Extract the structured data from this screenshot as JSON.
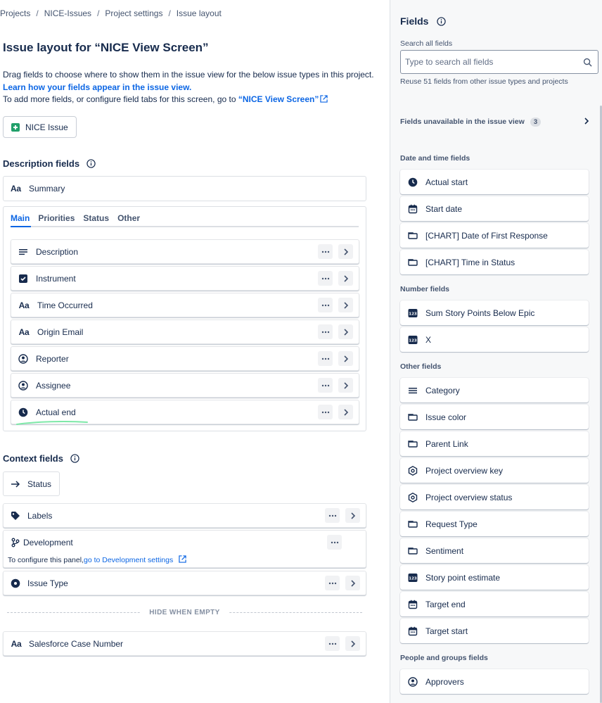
{
  "breadcrumb": [
    "Projects",
    "NICE-Issues",
    "Project settings",
    "Issue layout"
  ],
  "page_title": "Issue layout for “NICE View Screen”",
  "intro": {
    "line1": "Drag fields to choose where to show them in the issue view for the below issue types in this project. ",
    "link1": "Learn how your fields appear in the issue view.",
    "line2": "To add more fields, or configure field tabs for this screen, go to ",
    "link2": "“NICE View Screen”"
  },
  "issue_type_button": "NICE Issue",
  "description_section": {
    "title": "Description fields",
    "summary": "Summary",
    "tabs": [
      "Main",
      "Priorities",
      "Status",
      "Other"
    ],
    "rows": [
      "Description",
      "Instrument",
      "Time Occurred",
      "Origin Email",
      "Reporter",
      "Assignee",
      "Actual end"
    ]
  },
  "context_section": {
    "title": "Context fields",
    "status": "Status",
    "labels": "Labels",
    "development": "Development",
    "dev_note_prefix": "To configure this panel,",
    "dev_note_link": "go to Development settings",
    "issue_type": "Issue Type",
    "hide_when_empty": "HIDE WHEN EMPTY",
    "salesforce": "Salesforce Case Number"
  },
  "sidebar": {
    "title": "Fields",
    "search_label": "Search all fields",
    "search_placeholder": "Type to search all fields",
    "reuse_note": "Reuse 51 fields from other issue types and projects",
    "unavailable_label": "Fields unavailable in the issue view",
    "unavailable_count": "3",
    "groups": {
      "date": {
        "title": "Date and time fields",
        "items": [
          "Actual start",
          "Start date",
          "[CHART] Date of First Response",
          "[CHART] Time in Status"
        ]
      },
      "number": {
        "title": "Number fields",
        "items": [
          "Sum Story Points Below Epic",
          "X"
        ]
      },
      "other": {
        "title": "Other fields",
        "items": [
          "Category",
          "Issue color",
          "Parent Link",
          "Project overview key",
          "Project overview status",
          "Request Type",
          "Sentiment",
          "Story point estimate",
          "Target end",
          "Target start"
        ]
      },
      "people": {
        "title": "People and groups fields",
        "items": [
          "Approvers"
        ]
      }
    }
  },
  "colors": {
    "link": "#0c66e4",
    "accent_green": "#22a06b",
    "text": "#172b4d"
  }
}
